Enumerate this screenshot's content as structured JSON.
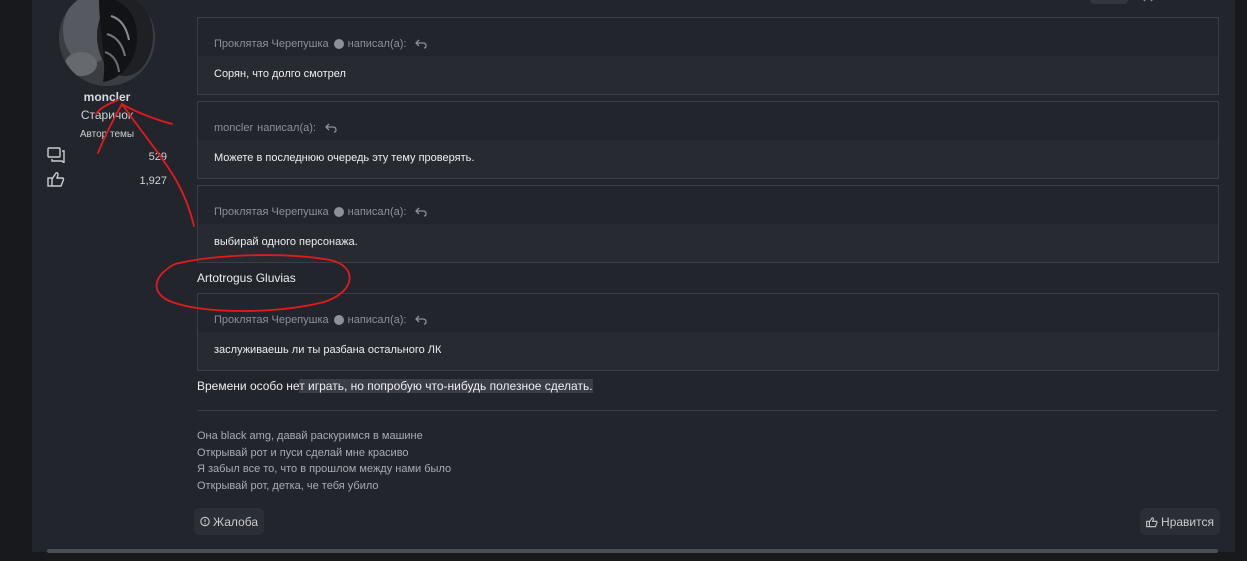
{
  "author": {
    "username": "moncler",
    "user_title": "Старичок",
    "badge": "Автор темы",
    "messages_count": "529",
    "reactions_count": "1,927"
  },
  "quotes": [
    {
      "header": "Проклятая Черепушка",
      "emoji": true,
      "said": "написал(а):",
      "body": "Сорян, что долго смотрел"
    },
    {
      "header": "moncler",
      "emoji": false,
      "said": "написал(а):",
      "body": "Можете в последнюю очередь эту тему проверять."
    },
    {
      "header": "Проклятая Черепушка",
      "emoji": true,
      "said": "написал(а):",
      "body": "выбирай одного персонажа."
    },
    {
      "header": "Проклятая Черепушка",
      "emoji": true,
      "said": "написал(а):",
      "body": "заслуживаешь ли ты разбана остального ЛК"
    }
  ],
  "reply_lines": {
    "answer_1": "Artotrogus Gluvias",
    "answer_2_part1": "Времени особо не",
    "answer_2_part2": "т играть, но попробую что-нибудь полезное сделать."
  },
  "signature": [
    "Она black amg, давай раскуримся в машине",
    "Открывай рот и пуси сделай мне красиво",
    "Я забыл все то, что в прошлом между нами было",
    "Открывай рот, детка, че тебя убило"
  ],
  "actions": {
    "report_label": "Жалоба",
    "like_label": "Нравится"
  },
  "icons": {
    "messages": "speech-bubbles-icon",
    "reactions": "thumbs-up-icon",
    "reply": "reply-arrow-icon",
    "report": "warning-circle-icon"
  },
  "colors": {
    "background": "#17191d",
    "post": "#22252b",
    "quote_body": "#272a30",
    "annotation": "#e11b1b"
  }
}
